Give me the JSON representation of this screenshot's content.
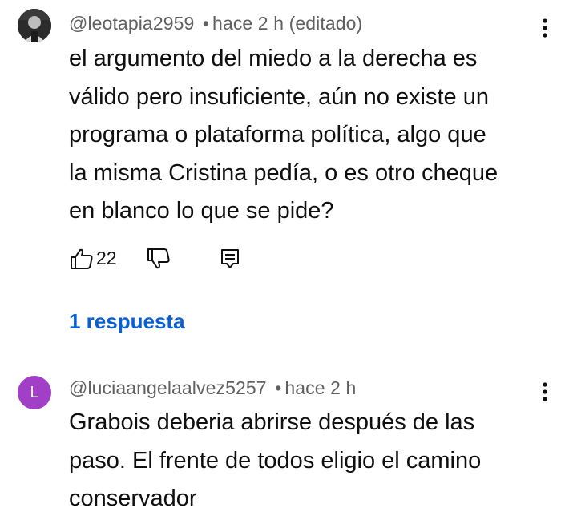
{
  "comments": [
    {
      "author": "@leotapia2959",
      "separator": "•",
      "time": "hace 2 h",
      "edited": "(editado)",
      "text_lines": [
        "el argumento del miedo a la derecha es",
        "válido pero insuficiente, aún no existe un",
        "programa o plataforma política, algo que",
        "la misma Cristina pedía, o es otro cheque",
        "en blanco lo que se pide?"
      ],
      "like_count": "22",
      "replies_label": "1 respuesta",
      "avatar_icon": "photo-avatar"
    },
    {
      "author": "@luciaangelaalvez5257",
      "separator": "•",
      "time": "hace 2 h",
      "avatar_letter": "L",
      "avatar_color": "#a23fc7",
      "text_lines": [
        "Grabois deberia abrirse después de las",
        "paso. El frente de todos eligio el camino",
        "conservador"
      ]
    }
  ],
  "colors": {
    "link": "#065fd4",
    "meta": "#606060",
    "text": "#0f0f0f"
  },
  "icons": [
    "thumbs-up-icon",
    "thumbs-down-icon",
    "reply-icon",
    "more-vert-icon"
  ]
}
